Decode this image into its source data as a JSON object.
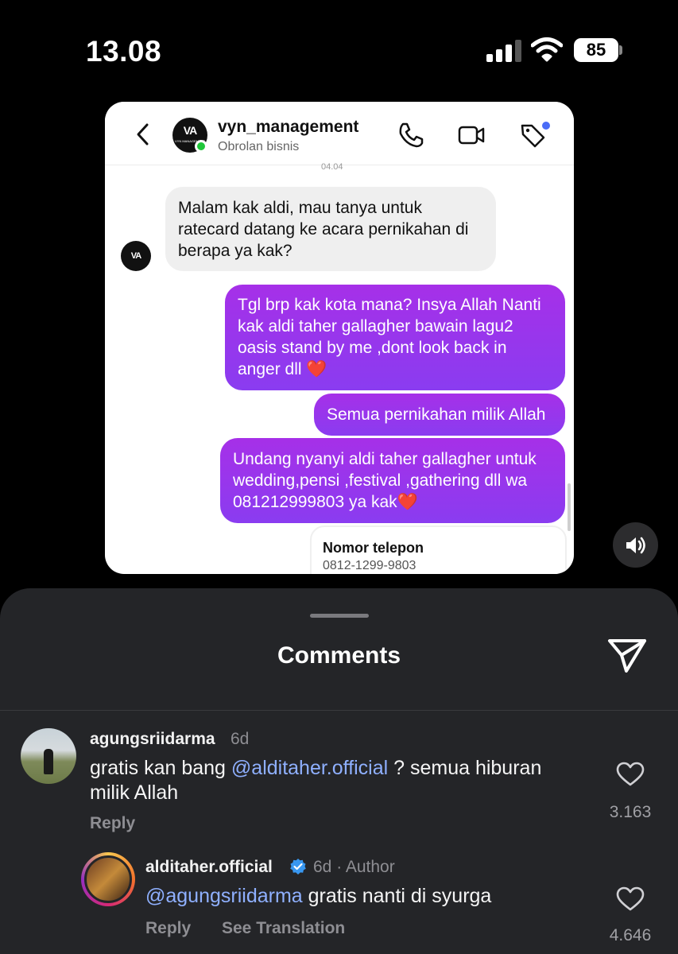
{
  "status_bar": {
    "time": "13.08",
    "battery": "85"
  },
  "dm": {
    "name": "vyn_management",
    "subtitle": "Obrolan bisnis",
    "avatar_logo": "VA",
    "avatar_logo_sub": "VYN MANAGEMENT",
    "timestamp_fragment": "04.04",
    "messages": [
      {
        "side": "in",
        "text": "Malam kak aldi, mau tanya untuk ratecard datang ke acara pernikahan di berapa ya kak?"
      },
      {
        "side": "out",
        "text": "Tgl brp kak kota mana? Insya Allah Nanti kak aldi taher gallagher bawain lagu2 oasis stand by me ,dont look back in anger dll ❤️"
      },
      {
        "side": "out",
        "text": "Semua pernikahan milik Allah"
      },
      {
        "side": "out",
        "text": "Undang nyanyi aldi taher gallagher untuk wedding,pensi ,festival ,gathering dll wa 081212999803 ya kak❤️"
      }
    ],
    "phone_card": {
      "label": "Nomor telepon",
      "number": "0812-1299-9803"
    }
  },
  "comments_sheet": {
    "title": "Comments",
    "comment": {
      "username": "agungsriidarma",
      "time": "6d",
      "text_before": "gratis kan bang ",
      "mention": "@alditaher.official",
      "text_after": " ? semua hiburan milik Allah",
      "reply_label": "Reply",
      "like_count": "3.163"
    },
    "reply": {
      "username": "alditaher.official",
      "meta": "6d · Author",
      "mention": "@agungsriidarma",
      "text": " gratis nanti di syurga",
      "reply_label": "Reply",
      "translate_label": "See Translation",
      "like_count": "4.646"
    }
  },
  "colors": {
    "bubble_out_top": "#a630e8",
    "bubble_out_bottom": "#8a3cf0",
    "mention": "#8fb0ff",
    "online": "#1fc73a",
    "verified": "#3897f0"
  }
}
